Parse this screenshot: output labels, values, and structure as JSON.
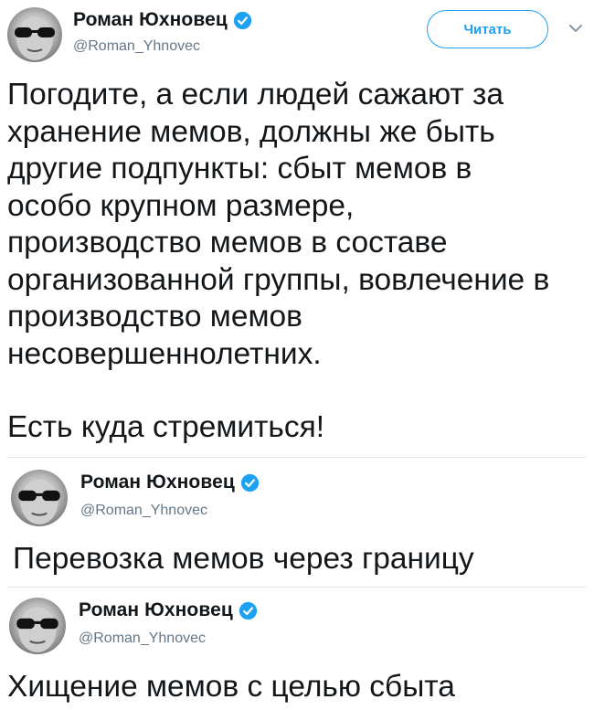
{
  "tweet_main": {
    "author_name": "Роман Юхновец",
    "handle": "@Roman_Yhnovec",
    "follow_label": "Читать",
    "text_lines": [
      "Погодите, а если людей сажают за",
      "хранение мемов, должны же быть",
      "другие подпункты: сбыт мемов в",
      "особо крупном размере,",
      "производство мемов в составе",
      "организованной группы, вовлечение в",
      "производство мемов",
      "несовершеннолетних."
    ],
    "text_para2": "Есть куда стремиться!"
  },
  "reply_1": {
    "author_name": "Роман Юхновец",
    "handle": "@Roman_Yhnovec",
    "text": "Перевозка мемов через границу"
  },
  "reply_2": {
    "author_name": "Роман Юхновец",
    "handle": "@Roman_Yhnovec",
    "text": "Хищение мемов с целью сбыта"
  },
  "colors": {
    "accent": "#1da1f2",
    "text": "#14171a",
    "secondary": "#657786",
    "divider": "#e1e8ed"
  },
  "icons": [
    "verified-badge-icon",
    "chevron-down-icon"
  ]
}
